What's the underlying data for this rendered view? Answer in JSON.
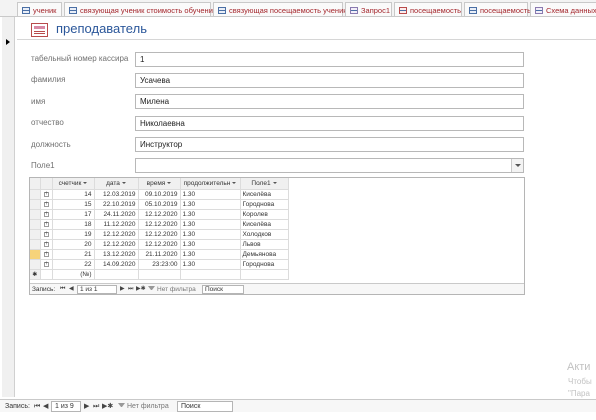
{
  "tabs": [
    {
      "label": "ученик",
      "icon": "table-icon",
      "active": false
    },
    {
      "label": "связующая ученик стоимость обучения",
      "icon": "table-icon",
      "active": false
    },
    {
      "label": "связующая посещаемость ученик",
      "icon": "table-icon",
      "active": false
    },
    {
      "label": "Запрос1",
      "icon": "query-icon",
      "active": false
    },
    {
      "label": "посещаемость",
      "icon": "form-icon",
      "active": false
    },
    {
      "label": "посещаемость",
      "icon": "table-icon",
      "active": false
    },
    {
      "label": "Схема данных",
      "icon": "relationship-icon",
      "active": false
    }
  ],
  "header": {
    "title": "преподаватель"
  },
  "fields": {
    "cashier": {
      "label": "табельный номер кассира",
      "value": "1"
    },
    "surname": {
      "label": "фамилия",
      "value": "Усачева"
    },
    "name": {
      "label": "имя",
      "value": "Милена"
    },
    "patronymic": {
      "label": "отчество",
      "value": "Николаевна"
    },
    "position": {
      "label": "должность",
      "value": "Инструктор"
    },
    "field1": {
      "label": "Поле1",
      "value": ""
    }
  },
  "subform": {
    "columns": [
      "счетчик",
      "дата",
      "время",
      "продолжительн",
      "Поле1"
    ],
    "rows": [
      {
        "counter": "14",
        "date": "12.03.2019",
        "time": "09.10.2019",
        "duration": "1.30",
        "field1": "Киселёва"
      },
      {
        "counter": "15",
        "date": "22.10.2019",
        "time": "05.10.2019",
        "duration": "1.30",
        "field1": "Городнова"
      },
      {
        "counter": "17",
        "date": "24.11.2020",
        "time": "12.12.2020",
        "duration": "1.30",
        "field1": "Королев"
      },
      {
        "counter": "18",
        "date": "11.12.2020",
        "time": "12.12.2020",
        "duration": "1.30",
        "field1": "Киселёва"
      },
      {
        "counter": "19",
        "date": "12.12.2020",
        "time": "12.12.2020",
        "duration": "1.30",
        "field1": "Холодков"
      },
      {
        "counter": "20",
        "date": "12.12.2020",
        "time": "12.12.2020",
        "duration": "1.30",
        "field1": "Львов"
      },
      {
        "counter": "21",
        "date": "13.12.2020",
        "time": "21.11.2020",
        "duration": "1.30",
        "field1": "Демьянова"
      },
      {
        "counter": "22",
        "date": "14.09.2020",
        "time": "23:23:00",
        "duration": "1.30",
        "field1": "Городнова"
      }
    ],
    "new_row_counter": "(№)",
    "nav": {
      "record_label": "Запись:",
      "position": "1 из 1",
      "filter": "Нет фильтра",
      "search": "Поиск"
    }
  },
  "bottom_nav": {
    "record_label": "Запись:",
    "position": "1 из 9",
    "filter": "Нет фильтра",
    "search": "Поиск"
  },
  "watermark": {
    "line1": "Акти",
    "line2": "Чтобы",
    "line3": "\"Пара"
  }
}
